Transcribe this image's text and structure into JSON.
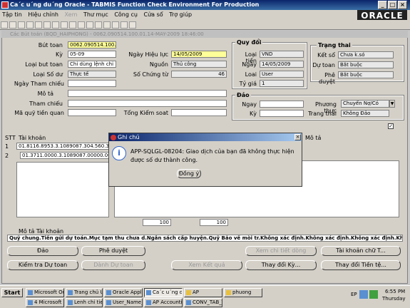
{
  "window": {
    "title": "Ca´c u´ng du´ng Oracle - TABMIS Function Check Environment For Production"
  },
  "menu": [
    "Tập tin",
    "Hiệu chỉnh",
    "Xem",
    "Thư mục",
    "Công cụ",
    "Cửa sổ",
    "Trợ giúp"
  ],
  "brand": "ORACLE",
  "form": {
    "title": "Các Bút toán (BQD_HAIPHONG) - 0062.090514.100.01.14-MAY-2009 18:46:00"
  },
  "header": {
    "but_toan": {
      "label": "Bút toan",
      "value": "0062.090514.100.01"
    },
    "ky": {
      "label": "Kỳ",
      "value": "05-09"
    },
    "ngay_hieu_luc": {
      "label": "Ngày Hiệu lực",
      "value": "14/05/2009"
    },
    "loai_but_toan": {
      "label": "Loại but toan",
      "value": "Chi dùng lệnh chi"
    },
    "nguon": {
      "label": "Nguồn",
      "value": "Thủ công"
    },
    "loai_so_du": {
      "label": "Loại Số dư",
      "value": "Thực tế"
    },
    "so_chung_tu": {
      "label": "Số Chứng từ",
      "value": "46"
    },
    "ngay_tham_chieu": {
      "label": "Ngày Tham chiếu",
      "value": ""
    },
    "mo_ta": {
      "label": "Mô tả",
      "value": ""
    },
    "tham_chieu": {
      "label": "Tham chiếu",
      "value": ""
    },
    "ma_quy_tien_quan": {
      "label": "Mã quỹ tiền quan",
      "value": ""
    },
    "tong_kiem_soat": {
      "label": "Tổng Kiểm soat",
      "value": ""
    }
  },
  "quy_doi": {
    "title": "Quy đổi",
    "loai_tien": {
      "label": "Loại tiền",
      "value": "VND"
    },
    "ngay": {
      "label": "Ngày",
      "value": "14/05/2009"
    },
    "loai": {
      "label": "Loai",
      "value": "User"
    },
    "ty_gia": {
      "label": "Tỷ giá",
      "value": "1"
    }
  },
  "trang_thai": {
    "title": "Trạng thai",
    "ket_so": {
      "label": "Kết sổ",
      "value": "Chưa k.só"
    },
    "du_toan": {
      "label": "Dự toan",
      "value": "Bắt buộc"
    },
    "phe_duyet": {
      "label": "Phê duyệt",
      "value": "Bắt buộc"
    }
  },
  "dao": {
    "title": "Đảo",
    "ngay": {
      "label": "Ngay",
      "value": ""
    },
    "ky": {
      "label": "Kỳ",
      "value": ""
    },
    "phuong_thuc": {
      "label": "Phương thưc",
      "value": "Chuyển Nợ/Có"
    },
    "trang_thai": {
      "label": "Trang thai",
      "value": "Không Đảo"
    }
  },
  "lines": {
    "col_stt": "STT",
    "col_tai_khoan": "Tài khoản",
    "col_mo_ta": "Mô tả",
    "rows": [
      {
        "stt": "1",
        "tk": "01.8116.8953.3.1089087.304.560.369.0"
      },
      {
        "stt": "2",
        "tk": "01.3711.0000.3.1089087.00000.000.00"
      }
    ],
    "total1": "100",
    "total2": "100"
  },
  "mo_ta_tk": {
    "label": "Mô tả Tài khoản",
    "value": "Quỹ chung.Tiền gửi dự toán.Mục tạm thu chưa d.Ngân sách cấp huyện.Quỹ Bảo về mòi tr.Không xác định.Không xác định.Không xác định.Không"
  },
  "buttons": {
    "dao": "Đảo",
    "phe_duyet": "Phê duyệt",
    "xem_chi_tiet": "Xem chi tiết dòng",
    "tai_khoan_chu": "Tài khoản chữ T...",
    "kiem_tra": "Kiểm tra Dự toan",
    "danh_du_toan": "Dành Dự toan",
    "xem_ket_qua": "Xem Kết quả",
    "thay_doi_ky": "Thay đổi Kỳ...",
    "thay_doi_tien": "Thay đổi Tiền tệ..."
  },
  "dialog": {
    "title": "Ghi chú",
    "message": "APP-SQLGL-08204: Giao dịch của bạn đã không thực hiện được số dư thành công.",
    "ok": "Đồng ý"
  },
  "taskbar": {
    "start": "Start",
    "row1": [
      "Microsoft Outl...",
      "Trang chủ Un...",
      "Oracle Applica...",
      "Ca´c u´ng d...",
      "AP",
      "phuong"
    ],
    "row2": [
      "4 Microsoft ...",
      "Lenh chi tien_...",
      "User_Name_T...",
      "AP Accountin...",
      "CONV_TAB_T..."
    ],
    "lang": "EP",
    "time": "6:55 PM",
    "day": "Thursday"
  }
}
